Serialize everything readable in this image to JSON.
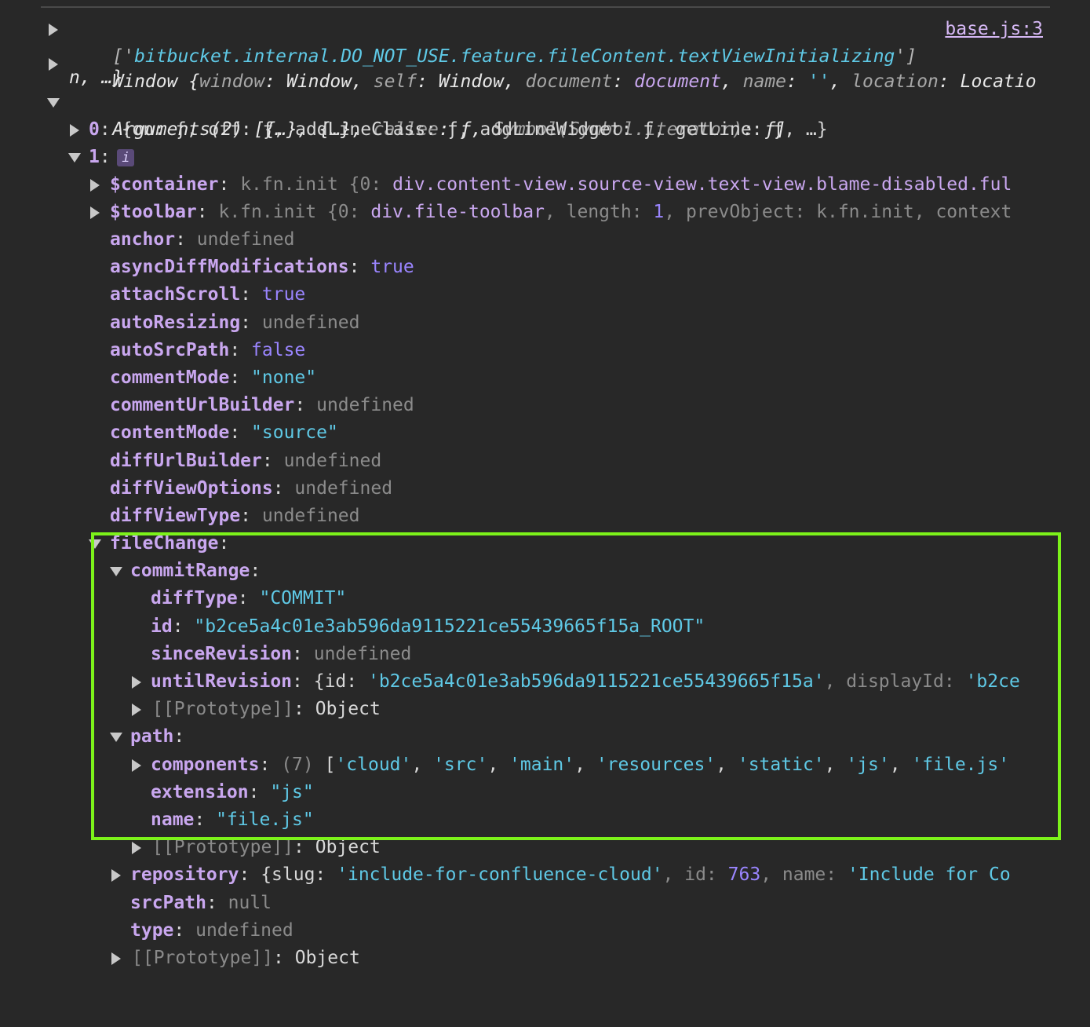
{
  "log_source_link": "base.js:3",
  "line1": {
    "open": "['",
    "value": "bitbucket.internal.DO_NOT_USE.feature.fileContent.textViewInitializing",
    "close": "']"
  },
  "line2": {
    "a": "Window {",
    "k1": "window",
    "v1": "Window",
    "k2": "self",
    "v2": "Window",
    "k3": "document",
    "v3": "document",
    "k4": "name",
    "v4": "''",
    "k5": "location",
    "v5": "Locatio",
    "cont": "n, …}"
  },
  "line3": {
    "a": "Arguments(2) [{…}, {…}, ",
    "k1": "callee",
    "v1": "ƒ",
    "k2": "Symbol(Symbol.iterator)",
    "v2": "ƒ",
    "close": "]",
    "info_icon_label": "i"
  },
  "arg0": {
    "key": "0",
    "preview": "{on: ƒ, off: ƒ, addLineClass: ƒ, addLineWidget: ƒ, getLine: ƒ, …}"
  },
  "arg1": {
    "key": "1"
  },
  "container": {
    "key": "$container",
    "a": "k.fn.init {0: ",
    "b": "div.content-view.source-view.text-view.blame-disabled.ful"
  },
  "toolbar": {
    "key": "$toolbar",
    "a": "k.fn.init {0: ",
    "b": "div.file-toolbar",
    "c": ", length: ",
    "d": "1",
    "e": ", prevObject: k.fn.init, context"
  },
  "props": [
    {
      "key": "anchor",
      "value": "undefined",
      "type": "u"
    },
    {
      "key": "asyncDiffModifications",
      "value": "true",
      "type": "b"
    },
    {
      "key": "attachScroll",
      "value": "true",
      "type": "b"
    },
    {
      "key": "autoResizing",
      "value": "undefined",
      "type": "u"
    },
    {
      "key": "autoSrcPath",
      "value": "false",
      "type": "b"
    },
    {
      "key": "commentMode",
      "value": "\"none\"",
      "type": "s"
    },
    {
      "key": "commentUrlBuilder",
      "value": "undefined",
      "type": "u"
    },
    {
      "key": "contentMode",
      "value": "\"source\"",
      "type": "s"
    },
    {
      "key": "diffUrlBuilder",
      "value": "undefined",
      "type": "u"
    },
    {
      "key": "diffViewOptions",
      "value": "undefined",
      "type": "u"
    },
    {
      "key": "diffViewType",
      "value": "undefined",
      "type": "u"
    }
  ],
  "fileChange": {
    "key": "fileChange",
    "commitRange": {
      "key": "commitRange",
      "diffType": {
        "key": "diffType",
        "value": "\"COMMIT\""
      },
      "id": {
        "key": "id",
        "value": "\"b2ce5a4c01e3ab596da9115221ce55439665f15a_ROOT\""
      },
      "sinceRevision": {
        "key": "sinceRevision",
        "value": "undefined"
      },
      "untilRevision": {
        "key": "untilRevision",
        "a": "{id: ",
        "b": "'b2ce5a4c01e3ab596da9115221ce55439665f15a'",
        "c": ", displayId: ",
        "d": "'b2ce"
      },
      "prototype": {
        "key": "[[Prototype]]",
        "value": "Object"
      }
    },
    "path": {
      "key": "path",
      "components": {
        "key": "components",
        "count": "(7)",
        "items": [
          "'cloud'",
          "'src'",
          "'main'",
          "'resources'",
          "'static'",
          "'js'",
          "'file.js'"
        ]
      },
      "extension": {
        "key": "extension",
        "value": "\"js\""
      },
      "name": {
        "key": "name",
        "value": "\"file.js\""
      },
      "prototype": {
        "key": "[[Prototype]]",
        "value": "Object"
      }
    },
    "repository": {
      "key": "repository",
      "a": "{slug: ",
      "b": "'include-for-confluence-cloud'",
      "c": ", id: ",
      "d": "763",
      "e": ", name: ",
      "f": "'Include for Co"
    },
    "srcPath": {
      "key": "srcPath",
      "value": "null"
    },
    "type": {
      "key": "type",
      "value": "undefined"
    },
    "prototype": {
      "key": "[[Prototype]]",
      "value": "Object"
    }
  },
  "colors": {
    "background": "#282828",
    "key": "#c9a7ef",
    "string": "#5fc9e6",
    "number_bool": "#9a85ff",
    "undefined": "#8b8b8b",
    "highlight_box": "#7cf21a"
  }
}
